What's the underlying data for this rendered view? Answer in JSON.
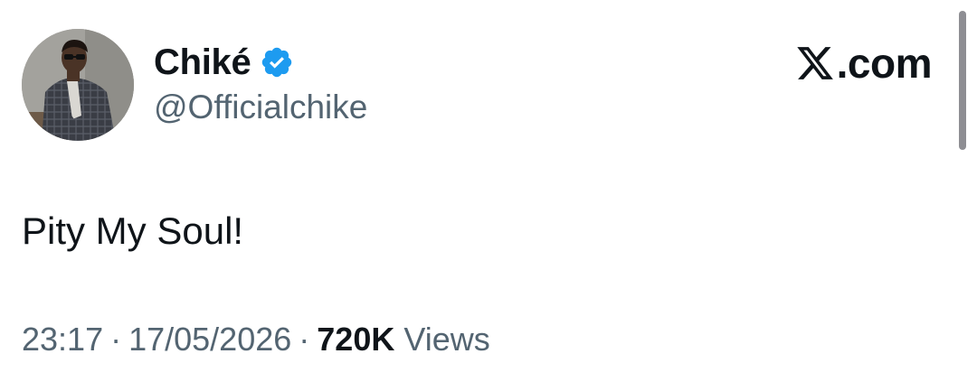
{
  "tweet": {
    "author": {
      "display_name": "Chiké",
      "handle": "@Officialchike",
      "verified": true,
      "verified_icon": "verified-badge-icon",
      "avatar": "profile-photo"
    },
    "brand": {
      "logo_icon": "x-logo-icon",
      "text": ".com"
    },
    "text": "Pity My Soul!",
    "meta": {
      "time": "23:17",
      "date": "17/05/2026",
      "separator": "·",
      "views_count": "720K",
      "views_label": "Views"
    }
  },
  "colors": {
    "text_primary": "#0f1419",
    "text_secondary": "#536471",
    "verified_blue": "#1d9bf0",
    "scrollbar": "#8e8e93"
  }
}
